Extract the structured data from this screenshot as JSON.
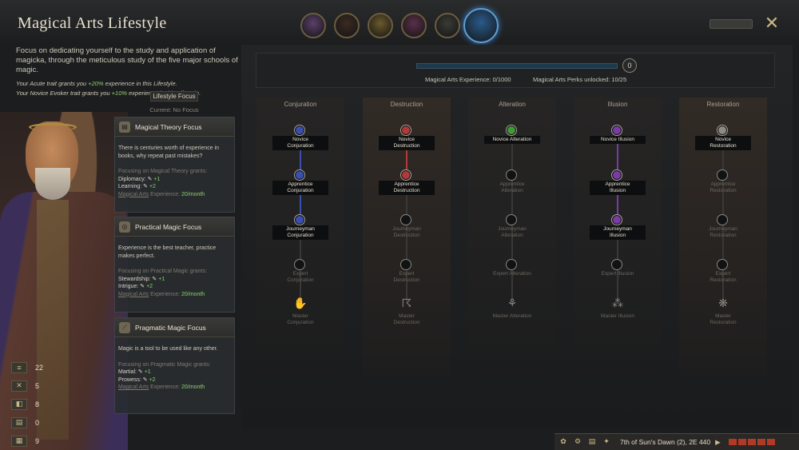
{
  "header": {
    "title": "Magical Arts Lifestyle",
    "close_icon": "close-icon"
  },
  "portraits": [
    {
      "name": "portrait-1",
      "color": "#5a3f6a",
      "selected": false
    },
    {
      "name": "portrait-2",
      "color": "#3b2a23",
      "selected": false
    },
    {
      "name": "portrait-3",
      "color": "#6b5a2a",
      "selected": false
    },
    {
      "name": "portrait-4",
      "color": "#5a2f4a",
      "selected": false
    },
    {
      "name": "portrait-5",
      "color": "#3a3a36",
      "selected": false
    },
    {
      "name": "portrait-6",
      "color": "#2a5a8a",
      "selected": true
    }
  ],
  "description": {
    "text": "Focus on dedicating yourself to the study and application of magicka, through the meticulous study of the five major schools of magic.",
    "trait1_prefix": "Your Acute trait grants you ",
    "trait1_pct": "+20%",
    "trait1_suffix": " experience in this Lifestyle.",
    "trait2_prefix": "Your Novice Evoker trait grants you ",
    "trait2_pct": "+10%",
    "trait2_suffix": " experience in this Lifestyle."
  },
  "focus": {
    "label": "Lifestyle Focus",
    "current": "Current: No Focus"
  },
  "cards": [
    {
      "title": "Magical Theory Focus",
      "icon": "book-icon",
      "desc": "There is centuries worth of experience in books, why repeat past mistakes?",
      "grants": "Focusing on Magical Theory grants:",
      "lines": [
        {
          "label": "Diplomacy:",
          "val": "+1"
        },
        {
          "label": "Learning:",
          "val": "+2"
        }
      ],
      "exp_prefix": "Magical Arts",
      "exp_mid": " Experience: ",
      "exp_val": "20/month"
    },
    {
      "title": "Practical Magic Focus",
      "icon": "spiral-icon",
      "desc": "Experience is the best teacher, practice makes perfect.",
      "grants": "Focusing on Practical Magic grants:",
      "lines": [
        {
          "label": "Stewardship:",
          "val": "+1"
        },
        {
          "label": "Intrigue:",
          "val": "+2"
        }
      ],
      "exp_prefix": "Magical Arts",
      "exp_mid": " Experience: ",
      "exp_val": "20/month"
    },
    {
      "title": "Pragmatic Magic Focus",
      "icon": "wand-icon",
      "desc": "Magic is a tool to be used like any other.",
      "grants": "Focusing on Pragmatic Magic grants:",
      "lines": [
        {
          "label": "Martial:",
          "val": "+1"
        },
        {
          "label": "Prowess:",
          "val": "+2"
        }
      ],
      "exp_prefix": "Magical Arts",
      "exp_mid": " Experience: ",
      "exp_val": "20/month"
    }
  ],
  "stats": [
    {
      "icon": "scroll-icon",
      "value": "22"
    },
    {
      "icon": "swords-icon",
      "value": "5"
    },
    {
      "icon": "coins-icon",
      "value": "8"
    },
    {
      "icon": "book-icon",
      "value": "0"
    },
    {
      "icon": "tome-icon",
      "value": "9"
    }
  ],
  "tree_header": {
    "experience": "Magical Arts Experience: 0/1000",
    "experience_progress": 0,
    "perks": "Magical Arts Perks unlocked: 10/25",
    "perk_points": "0"
  },
  "schools": [
    {
      "name": "Conjuration",
      "color": "#3b4fb0",
      "unlocked": 3,
      "ranks": [
        "Novice\nConjuration",
        "Apprentice\nConjuration",
        "Journeyman\nConjuration",
        "Expert\nConjuration"
      ],
      "master": "Master\nConjuration",
      "master_icon": "hand-icon"
    },
    {
      "name": "Destruction",
      "color": "#b03a3a",
      "unlocked": 2,
      "ranks": [
        "Novice\nDestruction",
        "Apprentice\nDestruction",
        "Journeyman\nDestruction",
        "Expert\nDestruction"
      ],
      "master": "Master\nDestruction",
      "master_icon": "claw-icon"
    },
    {
      "name": "Alteration",
      "color": "#3f9a3a",
      "unlocked": 1,
      "ranks": [
        "Novice Alteration",
        "Apprentice\nAlteration",
        "Journeyman\nAlteration",
        "Expert Alteration"
      ],
      "master": "Master Alteration",
      "master_icon": "figure-icon"
    },
    {
      "name": "Illusion",
      "color": "#7a3aa8",
      "unlocked": 3,
      "ranks": [
        "Novice Illusion",
        "Apprentice\nIllusion",
        "Journeyman\nIllusion",
        "Expert Illusion"
      ],
      "master": "Master Illusion",
      "master_icon": "orbs-icon"
    },
    {
      "name": "Restoration",
      "color": "#8e8b86",
      "unlocked": 1,
      "ranks": [
        "Novice\nRestoration",
        "Apprentice\nRestoration",
        "Journeyman\nRestoration",
        "Expert\nRestoration"
      ],
      "master": "Master\nRestoration",
      "master_icon": "wings-icon"
    }
  ],
  "footer": {
    "date": "7th of Sun's Dawn (2), 2E 440"
  }
}
